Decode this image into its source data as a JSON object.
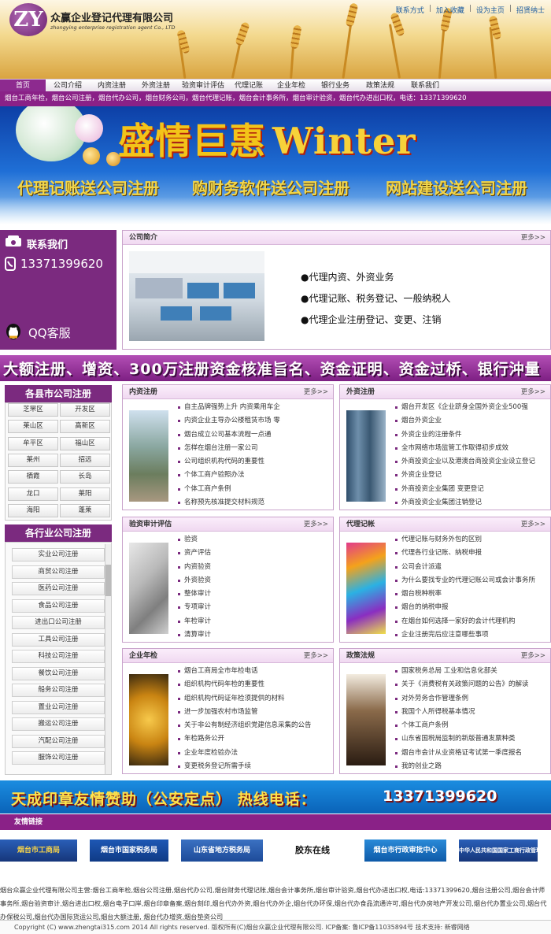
{
  "header": {
    "logo_mark": "ZY",
    "company_name": "众赢企业登记代理有限公司",
    "company_name_en": "zhongying enterprise registration agent Co., LTD",
    "top_links": [
      "联系方式",
      "加入收藏",
      "设为主页",
      "招贤纳士"
    ]
  },
  "nav": {
    "items": [
      "首页",
      "公司介绍",
      "内资注册",
      "外资注册",
      "验资审计评估",
      "代理记账",
      "企业年检",
      "银行业务",
      "政策法规",
      "联系我们"
    ]
  },
  "ticker": "烟台工商年检，烟台公司注册，烟台代办公司，烟台财务公司，烟台代理记账，烟台会计事务所，烟台审计验资，烟台代办进出口权，电话：13371399620",
  "banner": {
    "title": "盛情巨惠",
    "title_en": "Winter",
    "slogans": [
      "代理记账送公司注册",
      "购财务软件送公司注册",
      "网站建设送公司注册"
    ]
  },
  "contact": {
    "title": "联系我们",
    "phone": "13371399620",
    "qq": "QQ客服"
  },
  "intro": {
    "title": "公司简介",
    "more": "更多>>",
    "bullets": [
      "●代理内资、外资业务",
      "●代理记账、税务登记、一般纳税人",
      "●代理企业注册登记、变更、注销"
    ]
  },
  "strip_text": "大额注册、增资、300万注册资金核准旨名、资金证明、资金过桥、银行沖量",
  "county": {
    "title": "各县市公司注册",
    "items": [
      "芝罘区",
      "开发区",
      "莱山区",
      "高新区",
      "牟平区",
      "福山区",
      "莱州",
      "招远",
      "栖霞",
      "长岛",
      "龙口",
      "莱阳",
      "海阳",
      "蓬莱"
    ]
  },
  "industry": {
    "title": "各行业公司注册",
    "items": [
      "实业公司注册",
      "商贸公司注册",
      "医药公司注册",
      "食品公司注册",
      "进出口公司注册",
      "工具公司注册",
      "科技公司注册",
      "餐饮公司注册",
      "船务公司注册",
      "置业公司注册",
      "搬运公司注册",
      "汽配公司注册",
      "服饰公司注册"
    ]
  },
  "panels": [
    {
      "title": "内资注册",
      "more": "更多>>",
      "items": [
        "自主品牌强势上升 内资乘用车企",
        "内资企业主导办公楼租赁市场 零",
        "烟台成立公司基本流程一点通",
        "怎样在烟台注册一家公司",
        "公司组织机构代码的重要性",
        "个体工商户验照办法",
        "个体工商户条例",
        "名称预先核准提交材料规范"
      ]
    },
    {
      "title": "外资注册",
      "more": "更多>>",
      "items": [
        "烟台开发区《企业跻身全国外资企业500强",
        "烟台外资企业",
        "外资企业的注册条件",
        "全市网络市场监管工作取得初步成效",
        "外商投资企业以及港澳台商投资企业设立登记",
        "外资企业登记",
        "外商投资企业集团 变更登记",
        "外商投资企业集团注销登记"
      ]
    },
    {
      "title": "验资审计评估",
      "more": "更多>>",
      "items": [
        "验资",
        "资产评估",
        "内资验资",
        "外资验资",
        "整体审计",
        "专项审计",
        "年检审计",
        "清算审计"
      ]
    },
    {
      "title": "代理记帐",
      "more": "更多>>",
      "items": [
        "代理记账与财务外包的区别",
        "代理各行业记账、纳税申报",
        "公司会计派遣",
        "为什么要找专业的代理记账公司或会计事务所",
        "烟台税种税率",
        "烟台的纳税申报",
        "在烟台如何选择一家好的会计代理机构",
        "企业注册完后应注意哪些事项"
      ]
    },
    {
      "title": "企业年检",
      "more": "更多>>",
      "items": [
        "烟台工商局全市年检电话",
        "组织机构代码年检的重要性",
        "组织机构代码证年检须提供的材料",
        "进一步加强农村市场监管",
        "关于非公有制经济组织党建信息采集的公告",
        "年检路务公开",
        "企业年度检验办法",
        "变更税务登记所需手续"
      ]
    },
    {
      "title": "政策法规",
      "more": "更多>>",
      "items": [
        "国家税务总局 工业和信息化部关",
        "关于《消费税有关政策问题的公告》的解读",
        "对外劳务合作管理条例",
        "我国个人所得税基本情况",
        "个体工商户条例",
        "山东省国税局监制的新版普通发票种类",
        "烟台市会计从业资格证考试第一季度报名",
        "我的创业之路"
      ]
    }
  ],
  "stamp_banner": {
    "text": "天成印章友情赞助（公安定点）  热线电话：",
    "phone": "13371399620"
  },
  "friend_links": {
    "title": "友情链接",
    "partners": [
      "烟台市工商局",
      "烟台市国家税务局",
      "山东省地方税务局",
      "胶东在线",
      "烟台市行政审批中心",
      "中华人民共和国国家工商行政管理总局"
    ]
  },
  "footer": {
    "text": "烟台众赢企业代理有限公司主营:烟台工商年检,烟台公司注册,烟台代办公司,烟台财务代理记账,烟台会计事务所,烟台审计验资,烟台代办进出口权,电话:13371399620,烟台注册公司,烟台会计师事务所,烟台验资审计,烟台进出口权,烟台电子口岸,烟台印章备案,烟台刻印,烟台代办外资,烟台代办外企,烟台代办环保,烟台代办食品流通许可,烟台代办房地产开发公司,烟台代办置业公司,烟台代办保税公司,烟台代办国际货运公司,烟台大额注册, 烟台代办增资,烟台垫资公司",
    "copyright": "Copyright (C) www.zhengtai315.com 2014 All rights reserved. 版权所有(C)烟台众赢企业代理有限公司. ICP备案: 鲁ICP备11035894号   技术支持: 新睿网络"
  },
  "colors": {
    "brand_purple": "#7b2a7f",
    "nav_active": "#8d2a8f",
    "link_blue": "#1a5aa0",
    "banner_blue": "#1f6fd6"
  }
}
